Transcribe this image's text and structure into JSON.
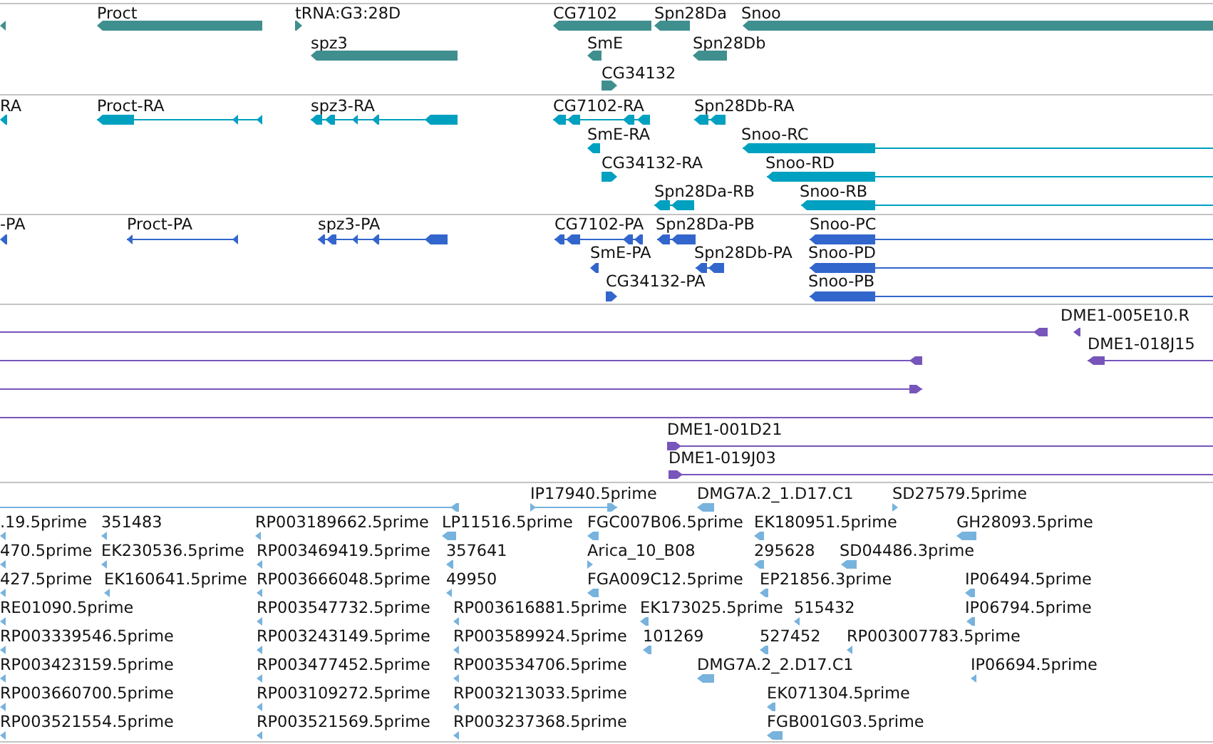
{
  "tracks": [
    {
      "kind": "gene",
      "color": "#3f8f8f",
      "features": [
        {
          "reverse": true
        },
        {
          "label": "Proct",
          "reverse": true
        },
        {
          "label": "tRNA:G3:28D",
          "reverse": false
        },
        {
          "label": "spz3",
          "reverse": true
        },
        {
          "label": "CG7102",
          "reverse": true
        },
        {
          "label": "Spn28Da",
          "reverse": true
        },
        {
          "label": "Snoo",
          "reverse": true
        },
        {
          "label": "SmE",
          "reverse": true
        },
        {
          "label": "Spn28Db",
          "reverse": true
        },
        {
          "label": "CG34132",
          "reverse": false
        }
      ]
    },
    {
      "kind": "transcript",
      "color": "#00a0c0",
      "features": [
        {
          "label": "RA",
          "reverse": true
        },
        {
          "label": "Proct-RA",
          "reverse": true
        },
        {
          "label": "spz3-RA",
          "reverse": true
        },
        {
          "label": "CG7102-RA",
          "reverse": true
        },
        {
          "label": "Spn28Db-RA",
          "reverse": true
        },
        {
          "label": "SmE-RA",
          "reverse": true
        },
        {
          "label": "Snoo-RC",
          "reverse": true
        },
        {
          "label": "CG34132-RA",
          "reverse": false
        },
        {
          "label": "Snoo-RD",
          "reverse": true
        },
        {
          "label": "Spn28Da-RB",
          "reverse": true
        },
        {
          "label": "Snoo-RB",
          "reverse": true
        }
      ]
    },
    {
      "kind": "protein",
      "color": "#3366cc",
      "features": [
        {
          "label": "-PA",
          "reverse": true
        },
        {
          "label": "Proct-PA",
          "reverse": true
        },
        {
          "label": "spz3-PA",
          "reverse": true
        },
        {
          "label": "CG7102-PA",
          "reverse": true
        },
        {
          "label": "Spn28Da-PB",
          "reverse": true
        },
        {
          "label": "Snoo-PC",
          "reverse": true
        },
        {
          "label": "SmE-PA",
          "reverse": true
        },
        {
          "label": "Spn28Db-PA",
          "reverse": true
        },
        {
          "label": "Snoo-PD",
          "reverse": true
        },
        {
          "label": "CG34132-PA",
          "reverse": false
        },
        {
          "label": "Snoo-PB",
          "reverse": true
        }
      ]
    },
    {
      "kind": "est",
      "color": "#7755bb",
      "features": [
        {
          "reverse": true
        },
        {
          "label": "DME1-005E10.R",
          "reverse": true
        },
        {
          "reverse": true
        },
        {
          "label": "DME1-018J15",
          "reverse": true
        },
        {
          "reverse": false
        },
        {
          "arrow": false
        },
        {
          "label": "DME1-001D21",
          "reverse": false
        },
        {
          "label": "DME1-019J03",
          "reverse": false
        }
      ]
    },
    {
      "kind": "read",
      "color": "#77b3dd",
      "features": [
        {
          "reverse": true
        },
        {
          "label": "IP17940.5prime",
          "reverse": false
        },
        {
          "label": "DMG7A.2_1.D17.C1",
          "reverse": true
        },
        {
          "label": "SD27579.5prime",
          "reverse": false
        },
        {
          "label": ".19.5prime",
          "reverse": true
        },
        {
          "label": "351483",
          "reverse": true
        },
        {
          "label": "RP003189662.5prime",
          "reverse": true
        },
        {
          "label": "LP11516.5prime",
          "reverse": true
        },
        {
          "label": "FGC007B06.5prime",
          "reverse": true
        },
        {
          "label": "EK180951.5prime",
          "reverse": true
        },
        {
          "label": "GH28093.5prime",
          "reverse": true
        },
        {
          "label": "470.5prime",
          "reverse": true
        },
        {
          "label": "EK230536.5prime",
          "reverse": true
        },
        {
          "label": "RP003469419.5prime",
          "reverse": true
        },
        {
          "label": "357641",
          "reverse": true
        },
        {
          "label": "Arica_10_B08",
          "reverse": false
        },
        {
          "label": "295628",
          "reverse": true
        },
        {
          "label": "SD04486.3prime",
          "reverse": true
        },
        {
          "label": "427.5prime",
          "reverse": true
        },
        {
          "label": "EK160641.5prime",
          "reverse": true
        },
        {
          "label": "RP003666048.5prime",
          "reverse": true
        },
        {
          "label": "49950",
          "reverse": true
        },
        {
          "label": "FGA009C12.5prime",
          "reverse": true
        },
        {
          "label": "EP21856.3prime",
          "reverse": true
        },
        {
          "label": "IP06494.5prime",
          "reverse": true
        },
        {
          "label": "RE01090.5prime",
          "reverse": true
        },
        {
          "label": "RP003547732.5prime",
          "reverse": true
        },
        {
          "label": "RP003616881.5prime",
          "reverse": true
        },
        {
          "label": "EK173025.5prime",
          "reverse": true
        },
        {
          "label": "515432",
          "reverse": true
        },
        {
          "label": "IP06794.5prime",
          "reverse": true
        },
        {
          "label": "RP003339546.5prime",
          "reverse": true
        },
        {
          "label": "RP003243149.5prime",
          "reverse": true
        },
        {
          "label": "RP003589924.5prime",
          "reverse": true
        },
        {
          "label": "101269",
          "reverse": true
        },
        {
          "label": "527452",
          "reverse": true
        },
        {
          "label": "RP003007783.5prime",
          "reverse": true
        },
        {
          "label": "RP003423159.5prime",
          "reverse": true
        },
        {
          "label": "RP003477452.5prime",
          "reverse": true
        },
        {
          "label": "RP003534706.5prime",
          "reverse": true
        },
        {
          "label": "DMG7A.2_2.D17.C1",
          "reverse": true
        },
        {
          "label": "IP06694.5prime",
          "reverse": true
        },
        {
          "label": "RP003660700.5prime",
          "reverse": true
        },
        {
          "label": "RP003109272.5prime",
          "reverse": true
        },
        {
          "label": "RP003213033.5prime",
          "reverse": true
        },
        {
          "label": "EK071304.5prime",
          "reverse": true
        },
        {
          "label": "RP003521554.5prime",
          "reverse": true
        },
        {
          "label": "RP003521569.5prime",
          "reverse": true
        },
        {
          "label": "RP003237368.5prime",
          "reverse": true
        },
        {
          "label": "FGB001G03.5prime",
          "reverse": true
        }
      ]
    }
  ]
}
